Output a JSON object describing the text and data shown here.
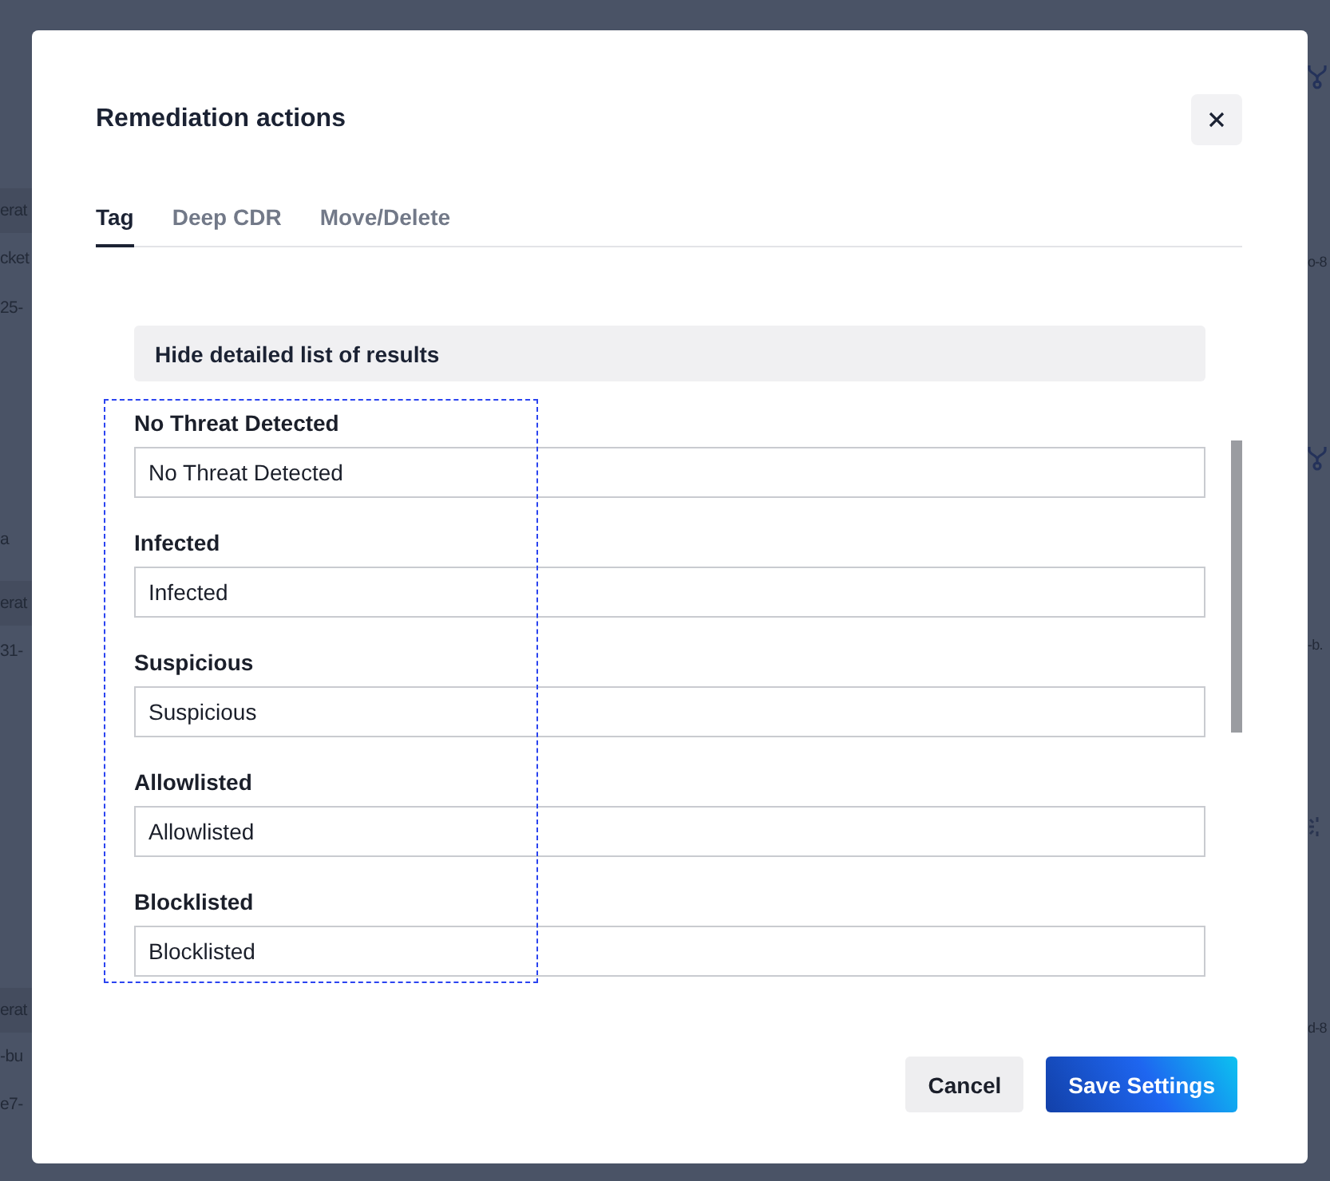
{
  "background": {
    "left_fragments": [
      "erat",
      "cket",
      "25-",
      "a",
      "erat",
      "31-",
      "erat",
      "-bu",
      "e7-"
    ],
    "right_fragments": [
      "o-8",
      "-b.",
      "d-8"
    ]
  },
  "dialog": {
    "title": "Remediation actions",
    "tabs": [
      {
        "label": "Tag",
        "selected": true
      },
      {
        "label": "Deep CDR",
        "selected": false
      },
      {
        "label": "Move/Delete",
        "selected": false
      }
    ],
    "toggle_results": "Hide detailed list of results",
    "highlight_box": true,
    "fields": [
      {
        "label": "No Threat Detected",
        "value": "No Threat Detected"
      },
      {
        "label": "Infected",
        "value": "Infected"
      },
      {
        "label": "Suspicious",
        "value": "Suspicious"
      },
      {
        "label": "Allowlisted",
        "value": "Allowlisted"
      },
      {
        "label": "Blocklisted",
        "value": "Blocklisted"
      }
    ],
    "buttons": [
      {
        "label": "Cancel",
        "kind": "secondary"
      },
      {
        "label": "Save Settings",
        "kind": "primary"
      }
    ]
  }
}
